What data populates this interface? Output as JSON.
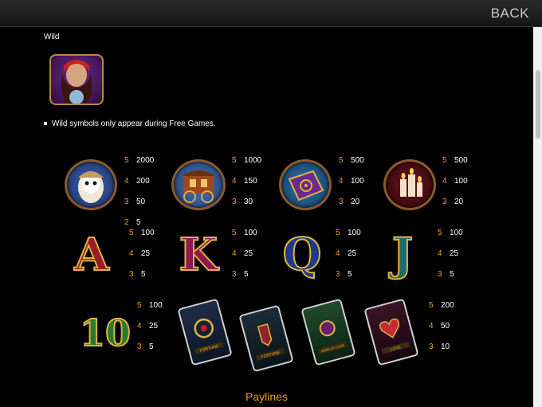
{
  "header": {
    "back_label": "BACK"
  },
  "wild": {
    "title": "Wild",
    "note": "Wild symbols only appear during Free Games."
  },
  "symbols": {
    "owl": [
      {
        "c": "5",
        "v": "2000"
      },
      {
        "c": "4",
        "v": "200"
      },
      {
        "c": "3",
        "v": "50"
      },
      {
        "c": "2",
        "v": "5"
      }
    ],
    "wagon": [
      {
        "c": "5",
        "v": "1000"
      },
      {
        "c": "4",
        "v": "150"
      },
      {
        "c": "3",
        "v": "30"
      }
    ],
    "book": [
      {
        "c": "5",
        "v": "500"
      },
      {
        "c": "4",
        "v": "100"
      },
      {
        "c": "3",
        "v": "20"
      }
    ],
    "candles": [
      {
        "c": "5",
        "v": "500"
      },
      {
        "c": "4",
        "v": "100"
      },
      {
        "c": "3",
        "v": "20"
      }
    ],
    "ace": {
      "glyph": "A",
      "pays": [
        {
          "c": "5",
          "v": "100"
        },
        {
          "c": "4",
          "v": "25"
        },
        {
          "c": "3",
          "v": "5"
        }
      ]
    },
    "king": {
      "glyph": "K",
      "pays": [
        {
          "c": "5",
          "v": "100"
        },
        {
          "c": "4",
          "v": "25"
        },
        {
          "c": "3",
          "v": "5"
        }
      ]
    },
    "queen": {
      "glyph": "Q",
      "pays": [
        {
          "c": "5",
          "v": "100"
        },
        {
          "c": "4",
          "v": "25"
        },
        {
          "c": "3",
          "v": "5"
        }
      ]
    },
    "jack": {
      "glyph": "J",
      "pays": [
        {
          "c": "5",
          "v": "100"
        },
        {
          "c": "4",
          "v": "25"
        },
        {
          "c": "3",
          "v": "5"
        }
      ]
    },
    "ten": {
      "glyph": "10",
      "pays": [
        {
          "c": "5",
          "v": "100"
        },
        {
          "c": "4",
          "v": "25"
        },
        {
          "c": "3",
          "v": "5"
        }
      ]
    },
    "tarot_cards": {
      "labels": [
        "FORTUNE",
        "FORTUNE",
        "WORLD LUCK",
        "LOVE"
      ],
      "pays": [
        {
          "c": "5",
          "v": "200"
        },
        {
          "c": "4",
          "v": "50"
        },
        {
          "c": "3",
          "v": "10"
        }
      ]
    }
  },
  "paylines_heading": "Paylines",
  "colors": {
    "count": "#f39b1f",
    "accent": "#f39b1f"
  }
}
